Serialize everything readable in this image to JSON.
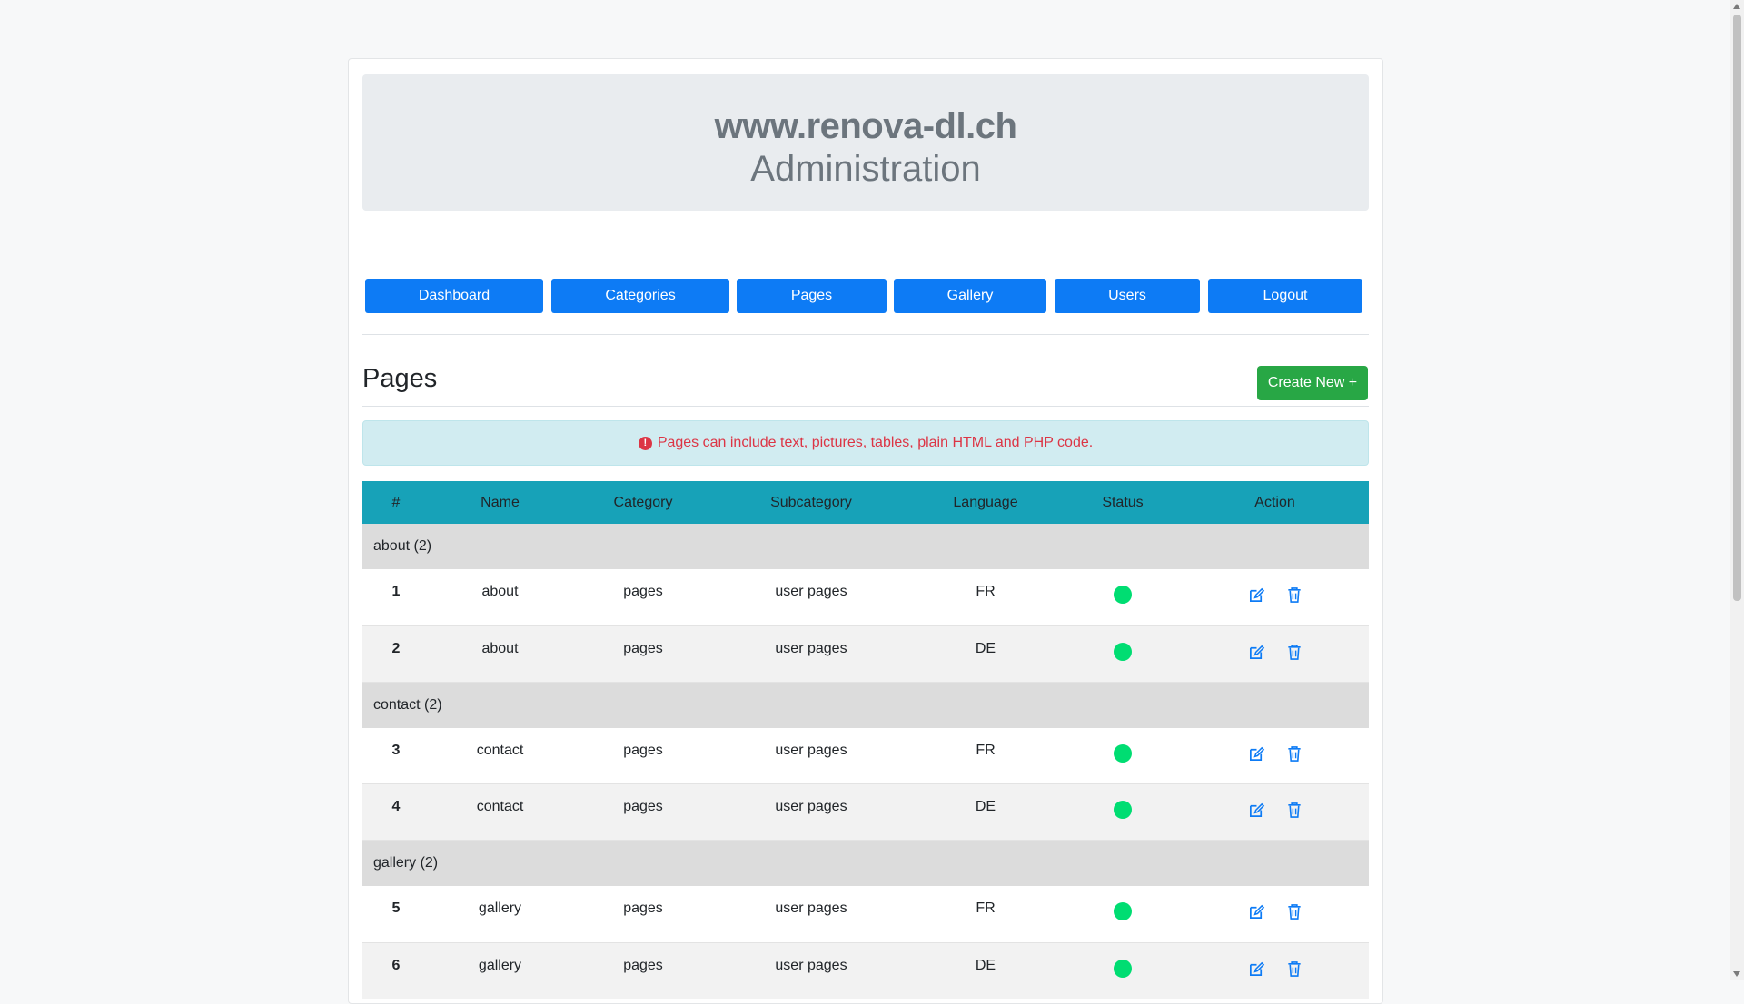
{
  "header": {
    "site": "www.renova-dl.ch",
    "subtitle": "Administration"
  },
  "nav": [
    {
      "label": "Dashboard"
    },
    {
      "label": "Categories"
    },
    {
      "label": "Pages"
    },
    {
      "label": "Gallery"
    },
    {
      "label": "Users"
    },
    {
      "label": "Logout"
    }
  ],
  "page": {
    "title": "Pages",
    "create_label": "Create New +"
  },
  "alert": {
    "icon": "exclamation-circle-icon",
    "text": "Pages can include text, pictures, tables, plain HTML and PHP code."
  },
  "table": {
    "headers": [
      "#",
      "Name",
      "Category",
      "Subcategory",
      "Language",
      "Status",
      "Action"
    ],
    "groups": [
      {
        "label": "about (2)",
        "rows": [
          {
            "num": "1",
            "name": "about",
            "category": "pages",
            "subcategory": "user pages",
            "language": "FR",
            "status": "active"
          },
          {
            "num": "2",
            "name": "about",
            "category": "pages",
            "subcategory": "user pages",
            "language": "DE",
            "status": "active"
          }
        ]
      },
      {
        "label": "contact (2)",
        "rows": [
          {
            "num": "3",
            "name": "contact",
            "category": "pages",
            "subcategory": "user pages",
            "language": "FR",
            "status": "active"
          },
          {
            "num": "4",
            "name": "contact",
            "category": "pages",
            "subcategory": "user pages",
            "language": "DE",
            "status": "active"
          }
        ]
      },
      {
        "label": "gallery (2)",
        "rows": [
          {
            "num": "5",
            "name": "gallery",
            "category": "pages",
            "subcategory": "user pages",
            "language": "FR",
            "status": "active"
          },
          {
            "num": "6",
            "name": "gallery",
            "category": "pages",
            "subcategory": "user pages",
            "language": "DE",
            "status": "active"
          }
        ]
      }
    ]
  },
  "colors": {
    "primary": "#0d7bf5",
    "success": "#28a745",
    "info": "#17a2b8",
    "status_active": "#00dd72",
    "alert_text": "#dc3545"
  }
}
